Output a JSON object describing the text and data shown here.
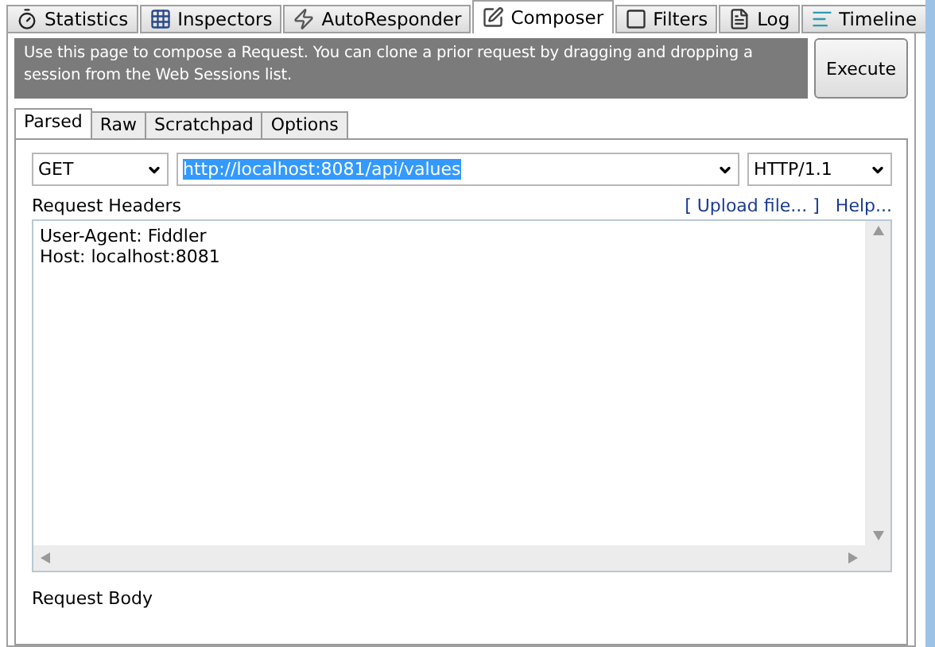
{
  "tabs": [
    {
      "label": "Statistics",
      "selected": false
    },
    {
      "label": "Inspectors",
      "selected": false
    },
    {
      "label": "AutoResponder",
      "selected": false
    },
    {
      "label": "Composer",
      "selected": true
    },
    {
      "label": "Filters",
      "selected": false
    },
    {
      "label": "Log",
      "selected": false
    },
    {
      "label": "Timeline",
      "selected": false
    }
  ],
  "info": "Use this page to compose a Request. You can clone a prior request by dragging and dropping a session from the Web Sessions list.",
  "execute_button": "Execute",
  "sub_tabs": [
    {
      "label": "Parsed",
      "selected": true
    },
    {
      "label": "Raw",
      "selected": false
    },
    {
      "label": "Scratchpad",
      "selected": false
    },
    {
      "label": "Options",
      "selected": false
    }
  ],
  "method": "GET",
  "url": "http://localhost:8081/api/values",
  "url_selected": true,
  "version": "HTTP/1.1",
  "headers_label": "Request Headers",
  "upload_link": "[ Upload file... ]",
  "help_link": "Help...",
  "headers": "User-Agent: Fiddler\nHost: localhost:8081",
  "body_label": "Request Body"
}
